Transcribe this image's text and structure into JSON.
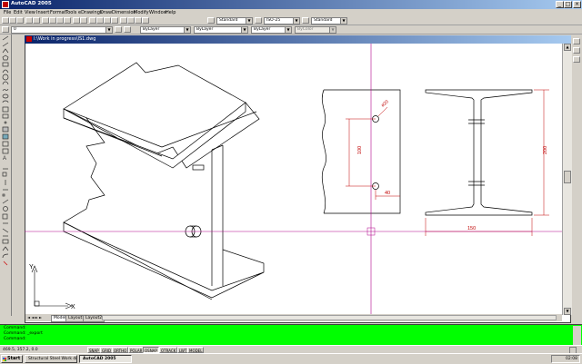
{
  "window": {
    "title": "AutoCAD 2005"
  },
  "menu": [
    "File",
    "Edit",
    "View",
    "Insert",
    "Format",
    "Tools",
    "eDrawings",
    "Draw",
    "Dimension",
    "Modify",
    "Window",
    "Help"
  ],
  "toolbar": {
    "text_style": "Standard",
    "dim_style": "ISO-25",
    "table_style": "Standard",
    "layer": "0",
    "color": "ByLayer",
    "linetype": "ByLayer",
    "lineweight": "ByLayer",
    "plotstyle": "ByColor"
  },
  "drawing": {
    "doc_title": "I:\\Work in progress\\IS1.dwg",
    "dims": {
      "d1": "ø20",
      "d2": "100",
      "d3": "40",
      "d4": "200",
      "d5": "150"
    },
    "ucs": {
      "x": "X",
      "y": "Y"
    }
  },
  "layout_tabs": [
    "Model",
    "Layout1",
    "Layout2"
  ],
  "command": {
    "line1": "Command:",
    "line2": "Command: _export",
    "line3": "Command:"
  },
  "status": {
    "coords": "469.5, 357.2, 0.0",
    "buttons": [
      "SNAP",
      "GRID",
      "ORTHO",
      "POLAR",
      "OSNAP",
      "OTRACK",
      "LWT",
      "MODEL"
    ],
    "active": [
      "OSNAP"
    ]
  },
  "taskbar": {
    "start": "Start",
    "tasks": [
      "Structural Steel Work dra...",
      "AutoCAD 2005"
    ],
    "clock": "02:08"
  },
  "colors": {
    "command_bg": "#00ff00",
    "crosshair": "#b0008c",
    "titlebar": "#0a246a"
  }
}
